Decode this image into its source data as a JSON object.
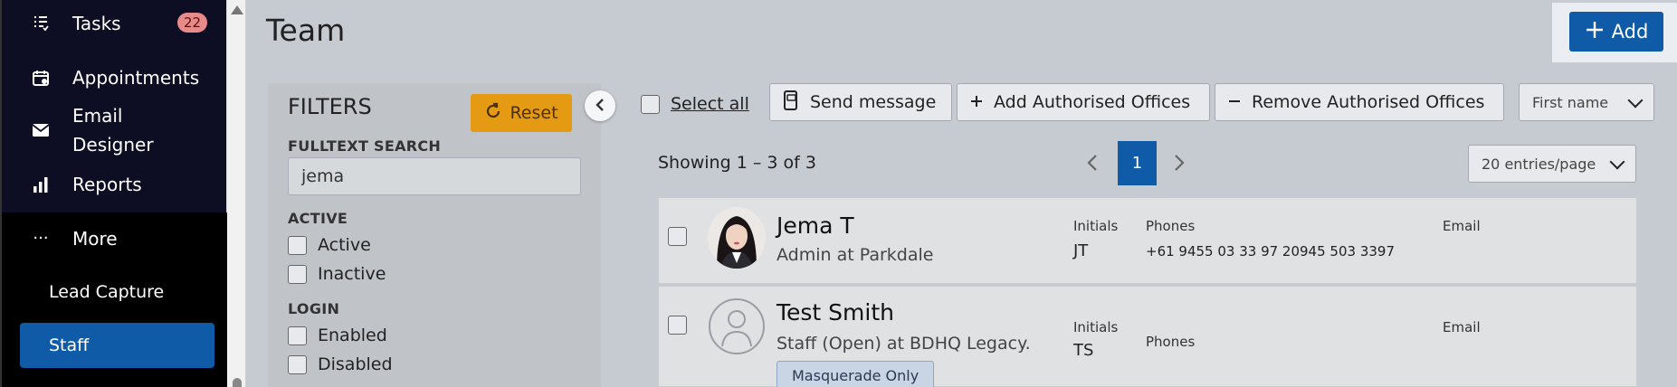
{
  "sidebar": {
    "items": [
      {
        "label": "Tasks",
        "badge": "22",
        "icon": "tasks-icon"
      },
      {
        "label": "Appointments",
        "icon": "calendar-icon"
      },
      {
        "label": "Email",
        "label2": "Designer",
        "icon": "mail-icon"
      },
      {
        "label": "Reports",
        "icon": "bar-chart-icon"
      },
      {
        "label": "More",
        "icon": "ellipsis-icon"
      }
    ],
    "sub_items": [
      {
        "label": "Lead Capture"
      },
      {
        "label": "Staff"
      }
    ]
  },
  "header": {
    "title": "Team",
    "add_label": "Add"
  },
  "filters": {
    "title": "FILTERS",
    "reset_label": "Reset",
    "fulltext_label": "FULLTEXT SEARCH",
    "search_value": "jema",
    "active_label": "ACTIVE",
    "active_options": [
      "Active",
      "Inactive"
    ],
    "login_label": "LOGIN",
    "login_options": [
      "Enabled",
      "Disabled"
    ]
  },
  "toolbar": {
    "select_all": "Select all",
    "send_message": "Send message",
    "add_offices": "Add Authorised Offices",
    "remove_offices": "Remove Authorised Offices",
    "sort_value": "First name"
  },
  "pagination": {
    "showing": "Showing 1 – 3 of 3",
    "current_page": "1",
    "per_page": "20 entries/page"
  },
  "members": [
    {
      "name": "Jema T",
      "role": "Admin at Parkdale",
      "initials_label": "Initials",
      "initials": "JT",
      "phones_label": "Phones",
      "phones": "+61 9455 03 33 97 20945 503 3397",
      "email_label": "Email"
    },
    {
      "name": "Test Smith",
      "role": "Staff (Open) at BDHQ Legacy.",
      "initials_label": "Initials",
      "initials": "TS",
      "phones_label": "Phones",
      "email_label": "Email",
      "tag": "Masquerade Only"
    }
  ],
  "colors": {
    "sidebar_bg": "#0d0e24",
    "accent": "#0f5ba8",
    "reset": "#e59a13",
    "badge": "#e88a8a"
  }
}
